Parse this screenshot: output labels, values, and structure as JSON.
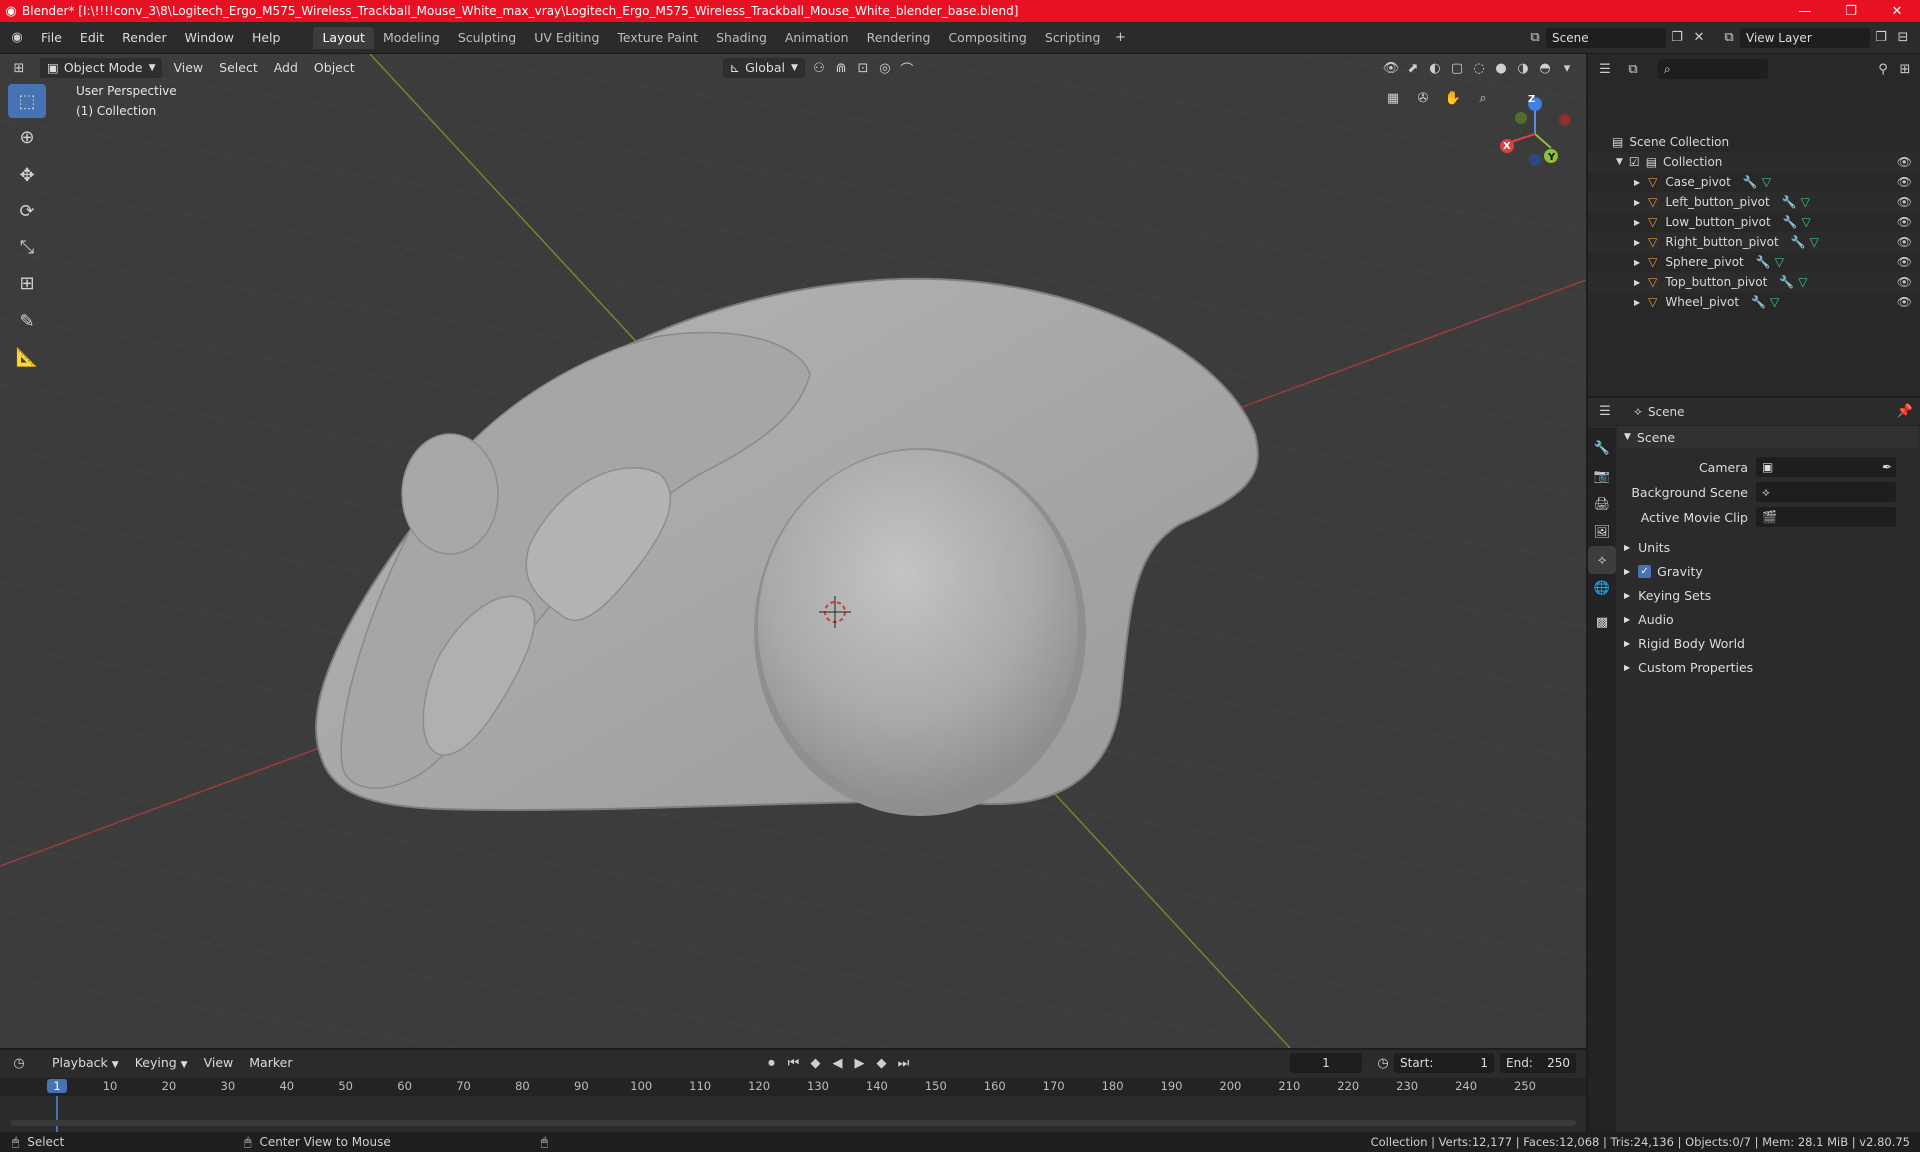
{
  "window": {
    "title": "Blender* [I:\\!!!!conv_3\\8\\Logitech_Ergo_M575_Wireless_Trackball_Mouse_White_max_vray\\Logitech_Ergo_M575_Wireless_Trackball_Mouse_White_blender_base.blend]",
    "minimize": "—",
    "maximize": "❐",
    "close": "✕"
  },
  "menu": {
    "file": "File",
    "edit": "Edit",
    "render": "Render",
    "window": "Window",
    "help": "Help"
  },
  "workspaces": [
    "Layout",
    "Modeling",
    "Sculpting",
    "UV Editing",
    "Texture Paint",
    "Shading",
    "Animation",
    "Rendering",
    "Compositing",
    "Scripting"
  ],
  "active_workspace": "Layout",
  "scene_field": "Scene",
  "view_layer_field": "View Layer",
  "viewport": {
    "mode": "Object Mode",
    "view_menu": "View",
    "select_menu": "Select",
    "add_menu": "Add",
    "object_menu": "Object",
    "orientation": "Global",
    "overlay_line1": "User Perspective",
    "overlay_line2": "(1) Collection",
    "gizmo": {
      "x": "X",
      "y": "Y",
      "z": "Z"
    }
  },
  "outliner": {
    "search_placeholder": "",
    "root": "Scene Collection",
    "collection": "Collection",
    "objects": [
      "Case_pivot",
      "Left_button_pivot",
      "Low_button_pivot",
      "Right_button_pivot",
      "Sphere_pivot",
      "Top_button_pivot",
      "Wheel_pivot"
    ]
  },
  "properties": {
    "header": "Scene",
    "section": "Scene",
    "camera_label": "Camera",
    "background_label": "Background Scene",
    "movieclip_label": "Active Movie Clip",
    "subpanels": [
      "Units",
      "Gravity",
      "Keying Sets",
      "Audio",
      "Rigid Body World",
      "Custom Properties"
    ]
  },
  "timeline": {
    "playback": "Playback",
    "keying": "Keying",
    "view": "View",
    "marker": "Marker",
    "current_frame": "1",
    "start_label": "Start:",
    "start_value": "1",
    "end_label": "End:",
    "end_value": "250",
    "ruler": [
      "1",
      "10",
      "20",
      "30",
      "40",
      "50",
      "60",
      "70",
      "80",
      "90",
      "100",
      "110",
      "120",
      "130",
      "140",
      "150",
      "160",
      "170",
      "180",
      "190",
      "200",
      "210",
      "220",
      "230",
      "240",
      "250"
    ]
  },
  "status": {
    "select": "Select",
    "center": "Center View to Mouse",
    "stats": "Collection | Verts:12,177 | Faces:12,068 | Tris:24,136 | Objects:0/7 | Mem: 28.1 MiB | v2.80.75"
  }
}
